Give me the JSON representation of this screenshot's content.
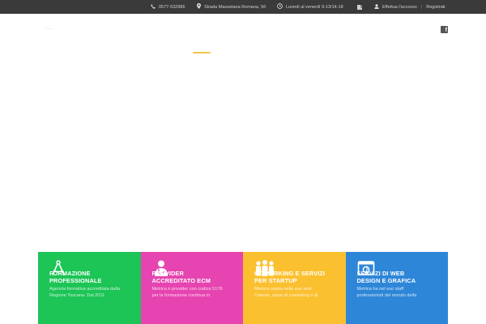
{
  "topbar": {
    "phone": "0577-532986",
    "address": "Strada Massetana Romana, 56",
    "hours": "Lunedì al venerdì 9-13/14-18",
    "login": "Effettua l'accesso",
    "separator": "|",
    "register": "Registrati",
    "phone_icon": "phone-icon",
    "address_icon": "map-marker-icon",
    "hours_icon": "clock-icon",
    "facebook_icon": "facebook-icon",
    "user_icon": "user-icon"
  },
  "header": {
    "facebook_icon": "facebook-icon"
  },
  "colors": {
    "topbar_bg": "#3a3a3a",
    "accent": "#f2c44a",
    "green": "#1dc456",
    "magenta": "#e644b0",
    "yellow": "#fbc030",
    "blue": "#2e86d8"
  },
  "services": [
    {
      "icon": "compass-icon",
      "title_line1": "FORMAZIONE",
      "title_line2": "PROFESSIONALE",
      "desc_line1": "Agenzia formativa accreditata dalla",
      "desc_line2": "Regione Toscana. Dal 2011"
    },
    {
      "icon": "doctor-icon",
      "title_line1": "PROVIDER",
      "title_line2": "ACCREDITATO ECM",
      "desc_line1": "Metrica è provider con codice 5176",
      "desc_line2": "per la formazione continua in"
    },
    {
      "icon": "team-icon",
      "title_line1": "COWORKING E SERVIZI",
      "title_line2": "PER STARTUP",
      "desc_line1": "Metrica ospita nelle sue sedi",
      "desc_line2": "Cowork, spazi di coworking e di"
    },
    {
      "icon": "browser-window-icon",
      "title_line1": "SERVIZI DI WEB",
      "title_line2": "DESIGN E GRAFICA",
      "desc_line1": "Metrica ha nel suo staff",
      "desc_line2": "professionisti del mondo della"
    }
  ]
}
